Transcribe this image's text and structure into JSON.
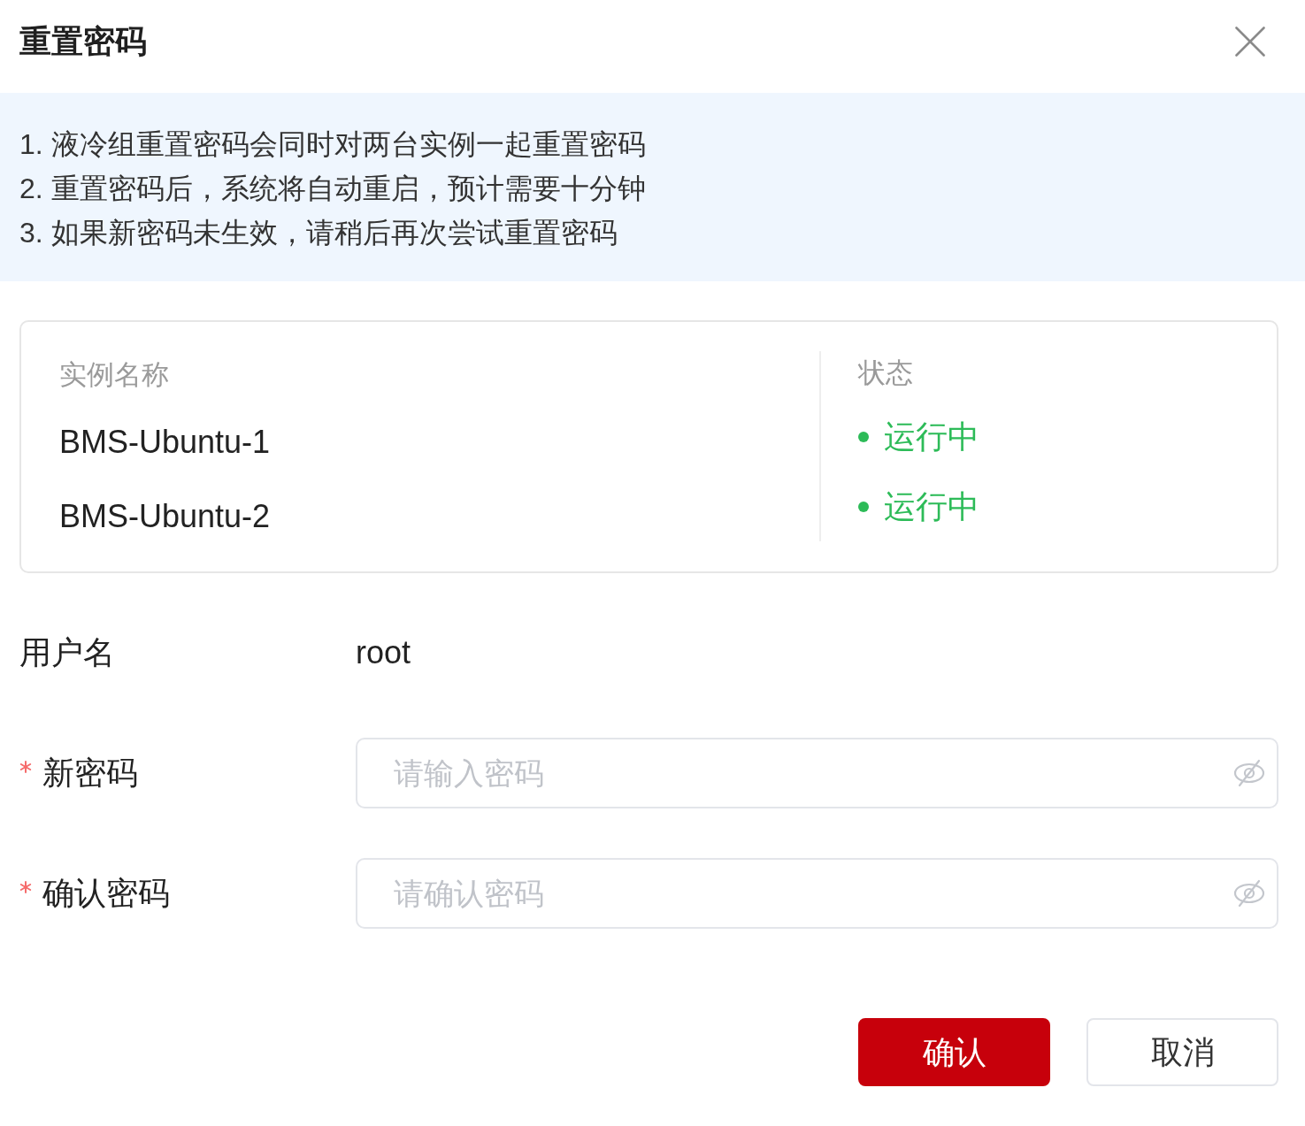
{
  "dialog": {
    "title": "重置密码"
  },
  "notice": [
    "1. 液冷组重置密码会同时对两台实例一起重置密码",
    "2. 重置密码后，系统将自动重启，预计需要十分钟",
    "3. 如果新密码未生效，请稍后再次尝试重置密码"
  ],
  "table": {
    "columns": [
      "实例名称",
      "状态"
    ],
    "rows": [
      {
        "name": "BMS-Ubuntu-1",
        "status": "运行中",
        "color": "#2dbb58"
      },
      {
        "name": "BMS-Ubuntu-2",
        "status": "运行中",
        "color": "#2dbb58"
      }
    ]
  },
  "form": {
    "fields": [
      {
        "kind": "text",
        "label": "用户名",
        "required": false,
        "value": "root"
      },
      {
        "kind": "password",
        "label": "新密码",
        "required": true,
        "placeholder": "请输入密码",
        "revealed": false
      },
      {
        "kind": "password",
        "label": "确认密码",
        "required": true,
        "placeholder": "请确认密码",
        "revealed": false
      }
    ]
  },
  "buttons": [
    {
      "label": "确认",
      "kind": "primary"
    },
    {
      "label": "取消",
      "kind": "secondary"
    }
  ]
}
